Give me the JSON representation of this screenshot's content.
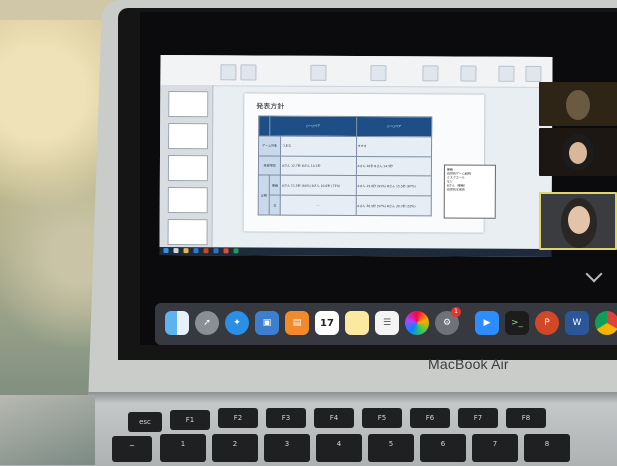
{
  "scene": {
    "brand_label": "MacBook Air"
  },
  "shared_screen": {
    "slide_title": "発表方針",
    "table": {
      "headers": [
        "",
        "○ー○ペア",
        "○ー○ペア"
      ],
      "rows": [
        {
          "label": "ゲーム対象",
          "c1": "つまむ",
          "c2": "すすき"
        },
        {
          "label": "発音時間",
          "c1": "Aさん 12.7秒  Bさん 14.1秒",
          "c2": "Aさん 16秒  Bさん 14.5秒"
        },
        {
          "label": "正解",
          "sub": "単語",
          "c1": "Aさん 11.5秒 (64%)  Bさん 10.6秒 (73%)",
          "c2": "Aさん 15.6秒 (91%)  Bさん 15.5秒 (87%)"
        },
        {
          "label": "",
          "sub": "文",
          "c1": "—",
          "c2": "Aさん 36.5秒 (57%)  Bさん 30.7秒 (53%)"
        }
      ]
    },
    "note_lines": [
      "単語",
      "自然的ゲーム説明",
      "ミスクエール",
      "など",
      "",
      "Bさん（単語）",
      "自然的な発音"
    ]
  },
  "dock": {
    "calendar_date": "17",
    "notification_badge": "1",
    "icons": [
      "finder-icon",
      "launchpad-icon",
      "safari-icon",
      "preview-icon",
      "books-icon",
      "calendar-icon",
      "notes-icon",
      "reminders-icon",
      "photos-icon",
      "system-preferences-icon",
      "zoom-icon",
      "terminal-icon",
      "powerpoint-icon",
      "word-icon",
      "chrome-icon"
    ]
  },
  "keyboard": {
    "row1": [
      "esc",
      "F1",
      "F2",
      "F3",
      "F4",
      "F5",
      "F6",
      "F7",
      "F8"
    ],
    "row2": [
      "~",
      "!",
      "@",
      "#",
      "$",
      "%",
      "^",
      "&",
      "*"
    ],
    "row2_sub": [
      "`",
      "1",
      "2",
      "3",
      "4",
      "5",
      "6",
      "7",
      "8"
    ]
  },
  "colors": {
    "slide_header": "#1d4f86",
    "active_speaker_border": "#e1d56a"
  }
}
